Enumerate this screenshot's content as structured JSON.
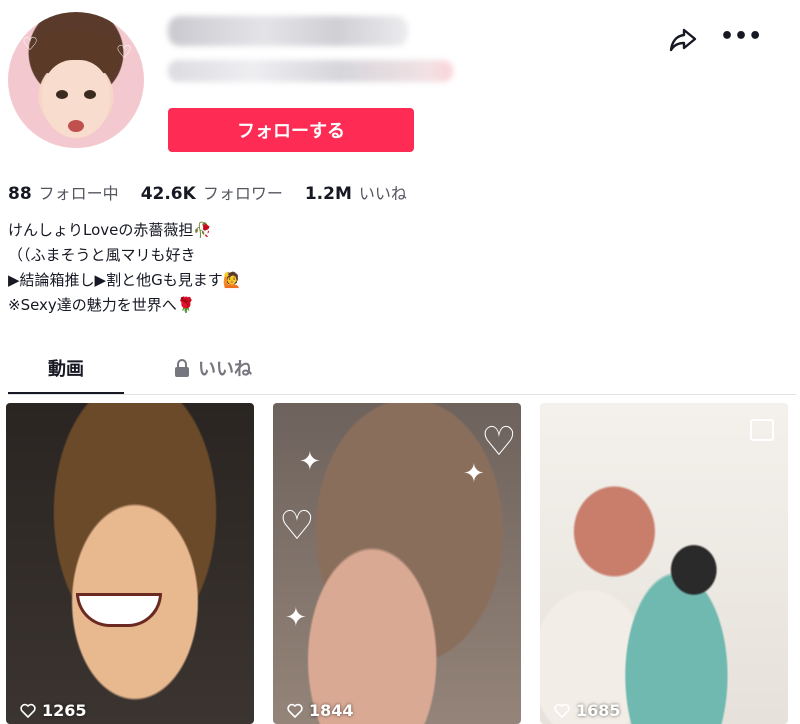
{
  "profile": {
    "follow_label": "フォローする"
  },
  "stats": {
    "following_count": "88",
    "following_label": "フォロー中",
    "followers_count": "42.6K",
    "followers_label": "フォロワー",
    "likes_count": "1.2M",
    "likes_label": "いいね"
  },
  "bio": {
    "line1": "けんしょりLoveの赤薔薇担🥀",
    "line2": "（（ふまそうと風マリも好き",
    "line3": "▶結論箱推し▶割と他Gも見ます🙋",
    "line4": "※Sexy達の魅力を世界へ🌹"
  },
  "tabs": {
    "videos": "動画",
    "likes": "いいね"
  },
  "videos": [
    {
      "views": "1265"
    },
    {
      "views": "1844"
    },
    {
      "views": "1685"
    }
  ],
  "icons": [
    "share-icon",
    "more-icon",
    "lock-icon",
    "heart-icon",
    "photo-icon"
  ],
  "colors": {
    "accent": "#fe2c55",
    "text": "#161823",
    "muted": "#75767e"
  }
}
